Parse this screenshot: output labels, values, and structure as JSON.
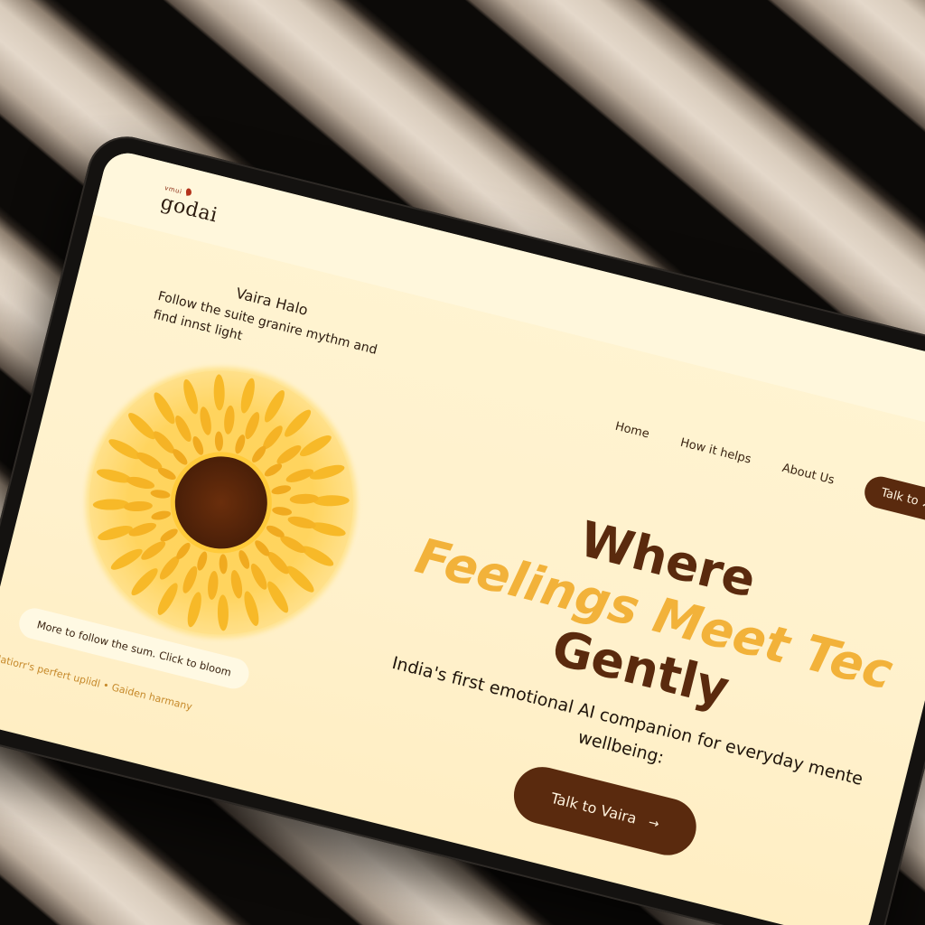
{
  "brand": {
    "tagline_small": "vmui",
    "name": "godai"
  },
  "nav": {
    "items": [
      {
        "label": "Home"
      },
      {
        "label": "How it helps"
      },
      {
        "label": "About Us"
      }
    ],
    "cta_label": "Talk to",
    "cta_icon": "send-icon"
  },
  "halo": {
    "title": "Vaira Halo",
    "subtitle": "Follow the suite granire mythm and find innst light",
    "bloom_hint": "More to follow the sum. Click to bloom",
    "footnote": "Natiorr's perfert uplidl • Gaiden harmany"
  },
  "hero": {
    "line1": "Where",
    "line2": "Feelings Meet Tec",
    "line3": "Gently",
    "subtitle_line1": "India's first emotional AI companion for everyday mente",
    "subtitle_line2": "wellbeing:",
    "cta_label": "Talk to Vaira",
    "cta_icon": "arrow-right-icon"
  },
  "colors": {
    "accent_brown": "#5a2a0e",
    "accent_yellow": "#f2b23a",
    "background_cream": "#fff1cc"
  }
}
